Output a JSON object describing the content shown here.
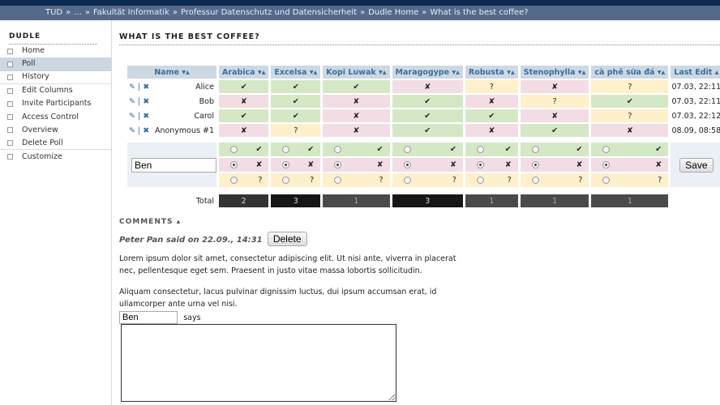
{
  "breadcrumb": [
    "TUD",
    "...",
    "Fakultät Informatik",
    "Professur Datenschutz und Datensicherheit",
    "Dudle Home",
    "What is the best coffee?"
  ],
  "sidebar": {
    "title": "DUDLE",
    "items": [
      {
        "label": "Home"
      },
      {
        "label": "Poll",
        "active": true
      },
      {
        "label": "History",
        "sep": true
      },
      {
        "label": "Edit Columns"
      },
      {
        "label": "Invite Participants"
      },
      {
        "label": "Access Control"
      },
      {
        "label": "Overview"
      },
      {
        "label": "Delete Poll",
        "sep": true
      },
      {
        "label": "Customize"
      }
    ]
  },
  "page_title": "WHAT IS THE BEST COFFEE?",
  "poll": {
    "name_header": "Name ▾▴",
    "last_edit_header": "Last Edit ▴",
    "columns": [
      "Arabica ▾▴",
      "Excelsa ▾▴",
      "Kopi Luwak ▾▴",
      "Maragogype ▾▴",
      "Robusta ▾▴",
      "Stenophylla ▾▴",
      "cà phê sữa đá ▾▴"
    ],
    "symbols": {
      "y": "✔",
      "n": "✘",
      "m": "?"
    },
    "edit_icons": "✎ | ✖",
    "rows": [
      {
        "name": "Alice",
        "votes": [
          "y",
          "y",
          "y",
          "n",
          "m",
          "n",
          "m"
        ],
        "last_edit": "07.03, 22:11"
      },
      {
        "name": "Bob",
        "votes": [
          "n",
          "y",
          "n",
          "y",
          "n",
          "m",
          "y"
        ],
        "last_edit": "07.03, 22:11"
      },
      {
        "name": "Carol",
        "votes": [
          "y",
          "y",
          "n",
          "y",
          "y",
          "n",
          "m"
        ],
        "last_edit": "07.03, 22:12"
      },
      {
        "name": "Anonymous #1",
        "votes": [
          "n",
          "m",
          "n",
          "y",
          "n",
          "y",
          "n"
        ],
        "last_edit": "08.09, 08:58"
      }
    ],
    "new_name": "Ben",
    "selected": "n",
    "save_label": "Save",
    "total_label": "Total",
    "totals": [
      2,
      3,
      1,
      3,
      1,
      1,
      1
    ]
  },
  "comments": {
    "title": "COMMENTS ▴",
    "author_line": "Peter Pan said on 22.09., 14:31",
    "delete_label": "Delete",
    "text1": "Lorem ipsum dolor sit amet, consectetur adipiscing elit. Ut nisi ante, viverra in placerat nec, pellentesque eget sem. Praesent in justo vitae massa lobortis sollicitudin.",
    "text2": "Aliquam consectetur, lacus pulvinar dignissim luctus, dui ipsum accumsan erat, id ullamcorper ante urna vel nisi.",
    "name_value": "Ben",
    "says": "says"
  }
}
